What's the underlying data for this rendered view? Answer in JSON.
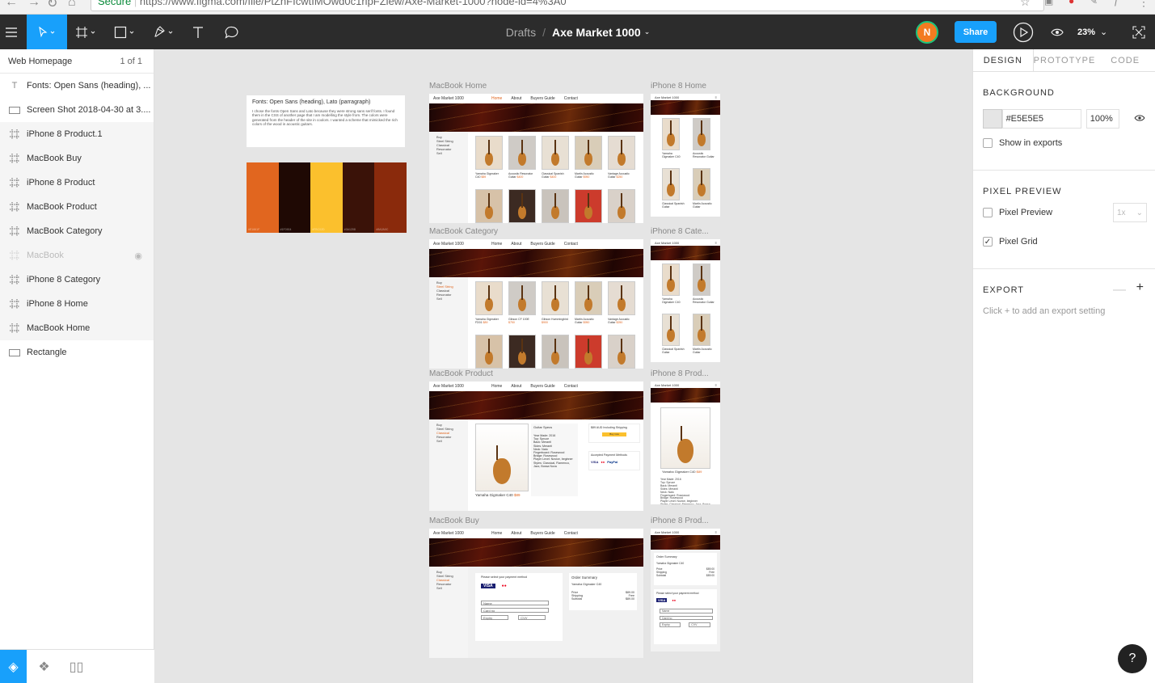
{
  "browser": {
    "secure_label": "Secure",
    "url": "https://www.figma.com/file/PtZnFIcwtIMOwd0c1ripFZiew/Axe-Market-1000?node-id=4%3A0"
  },
  "toolbar": {
    "breadcrumb_root": "Drafts",
    "breadcrumb_sep": "/",
    "file_name": "Axe Market 1000",
    "avatar_initial": "N",
    "share_label": "Share",
    "zoom": "23%"
  },
  "layers": {
    "page_name": "Web Homepage",
    "page_count": "1 of 1",
    "items": [
      {
        "label": "Fonts: Open Sans (heading), ...",
        "kind": "text"
      },
      {
        "label": "Screen Shot 2018-04-30 at 3....",
        "kind": "rect"
      },
      {
        "label": "iPhone 8 Product.1",
        "kind": "frame"
      },
      {
        "label": "MacBook Buy",
        "kind": "frame"
      },
      {
        "label": "iPhone 8 Product",
        "kind": "frame"
      },
      {
        "label": "MacBook Product",
        "kind": "frame"
      },
      {
        "label": "MacBook Category",
        "kind": "frame"
      },
      {
        "label": "MacBook",
        "kind": "hidden"
      },
      {
        "label": "iPhone 8 Category",
        "kind": "frame"
      },
      {
        "label": "iPhone 8 Home",
        "kind": "frame"
      },
      {
        "label": "MacBook Home",
        "kind": "frame"
      },
      {
        "label": "Rectangle",
        "kind": "rect"
      }
    ]
  },
  "properties": {
    "tabs": [
      "DESIGN",
      "PROTOTYPE",
      "CODE"
    ],
    "background_heading": "BACKGROUND",
    "background_hex": "#E5E5E5",
    "background_opacity": "100%",
    "show_in_exports": "Show in exports",
    "pixel_preview_heading": "PIXEL PREVIEW",
    "pixel_preview_label": "Pixel Preview",
    "pixel_preview_scale": "1x",
    "pixel_grid_label": "Pixel Grid",
    "export_heading": "EXPORT",
    "export_hint": "Click + to add an export setting",
    "help": "?"
  },
  "canvas": {
    "notes_title": "Fonts: Open Sans (heading), Lato (parragraph)",
    "notes_body": "I chose the fonts Open Sans and Lato because they were strong sans serif fonts. I found them in the CSS of another page that I am modelling the style from. The colors were generated from the header of the site in coolors. I wanted a scheme that mimicked the rich colors of the wood in acoustic guitars.",
    "palette": [
      {
        "hex": "#E1661F",
        "label": "#E1661F"
      },
      {
        "hex": "#1F0904",
        "label": "#1F0904"
      },
      {
        "hex": "#FBC02D",
        "label": "#FBC02D"
      },
      {
        "hex": "#3A1208",
        "label": "#3A1208"
      },
      {
        "hex": "#8A2A0C",
        "label": "#8A2A0C"
      }
    ],
    "frames": {
      "macbook_home": "MacBook Home",
      "iphone_home": "iPhone 8 Home",
      "macbook_category": "MacBook Category",
      "iphone_category": "iPhone 8 Cate...",
      "macbook_product": "MacBook Product",
      "iphone_product": "iPhone 8 Prod...",
      "macbook_buy": "MacBook Buy",
      "iphone_product1": "iPhone 8 Prod..."
    },
    "site": {
      "brand": "Axe Market 1000",
      "nav": [
        "Home",
        "About",
        "Buyers Guide",
        "Contact"
      ],
      "side": [
        "Buy",
        "Steel String",
        "Classical",
        "Resonator",
        "Sell"
      ],
      "home_products": [
        {
          "name": "Yamaha Gigmaker C40",
          "price": "$89"
        },
        {
          "name": "Acoustic Resonator Guitar",
          "price": "$400"
        },
        {
          "name": "Classical Spanish Guitar",
          "price": "$400"
        },
        {
          "name": "Martin Acoustic Guitar",
          "price": "$950"
        },
        {
          "name": "Vantage Acoustic Guitar",
          "price": "$250"
        }
      ],
      "category_products": [
        {
          "name": "Yamaha Gigmaker FD01",
          "price": "$89"
        },
        {
          "name": "Gibson CF 100E",
          "price": "$750"
        },
        {
          "name": "Gibson Hummingbird",
          "price": "$900"
        },
        {
          "name": "Martin Acoustic Guitar",
          "price": "$950"
        },
        {
          "name": "Vantage Acoustic Guitar",
          "price": "$250"
        }
      ],
      "product_name": "Yamaha Gigmaker C40",
      "product_price": "$89",
      "specs_title": "Guitar Specs",
      "specs": "Year Made: 2016\nTop: Spruce\nBack: Meranti\nSides: Meranti\nNeck: Nato\nFingerboard: Rosewood\nBridge: Rosewood\nPlayer Level: Novice, beginner\nStyles: Classical, Flamenco, Jazz, Bossa Nova",
      "shipping_line": "$89 AUD Including Shipping",
      "buy_now": "Buy now",
      "payment_methods": "Accepted Payment Methods",
      "order_summary": "Order Summary",
      "payment_prompt": "Please select your payment method",
      "card_fields": [
        "Name",
        "Card no",
        "Expiry",
        "CVV"
      ],
      "summary_rows": "Price\nShipping\nSubtotal",
      "summary_vals": "$89.00\nFree\n$89.00"
    }
  }
}
